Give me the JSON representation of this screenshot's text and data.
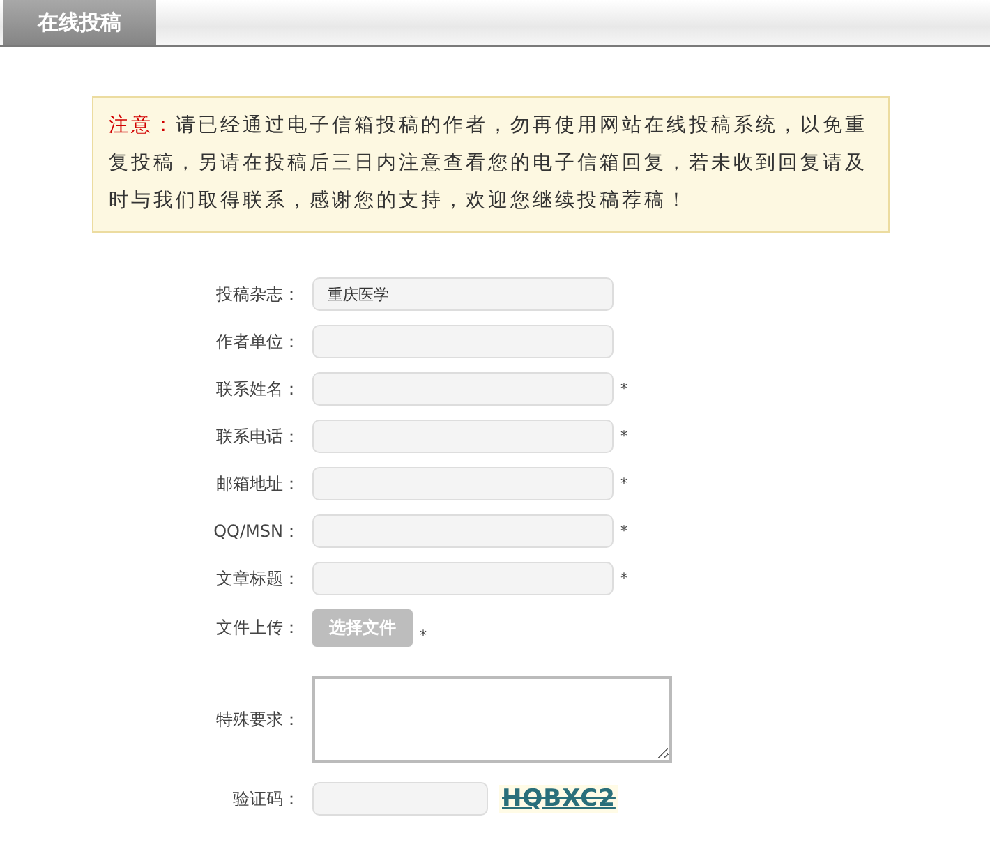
{
  "header": {
    "tab": "在线投稿"
  },
  "notice": {
    "label": "注意：",
    "text": "请已经通过电子信箱投稿的作者，勿再使用网站在线投稿系统，以免重复投稿，另请在投稿后三日内注意查看您的电子信箱回复，若未收到回复请及时与我们取得联系，感谢您的支持，欢迎您继续投稿荐稿！"
  },
  "fields": [
    {
      "kind": "text",
      "label": "投稿杂志：",
      "value": "重庆医学",
      "required": false
    },
    {
      "kind": "text",
      "label": "作者单位：",
      "required": false
    },
    {
      "kind": "text",
      "label": "联系姓名：",
      "required": true
    },
    {
      "kind": "text",
      "label": "联系电话：",
      "required": true
    },
    {
      "kind": "text",
      "label": "邮箱地址：",
      "required": true
    },
    {
      "kind": "text",
      "label": "QQ/MSN：",
      "required": true
    },
    {
      "kind": "text",
      "label": "文章标题：",
      "required": true
    },
    {
      "kind": "file",
      "label": "文件上传：",
      "button": "选择文件",
      "required": true
    },
    {
      "kind": "textarea",
      "label": "特殊要求：",
      "required": false
    },
    {
      "kind": "captcha",
      "label": "验证码：",
      "code": "HQBXC2",
      "required": false
    }
  ],
  "required_mark": "*"
}
